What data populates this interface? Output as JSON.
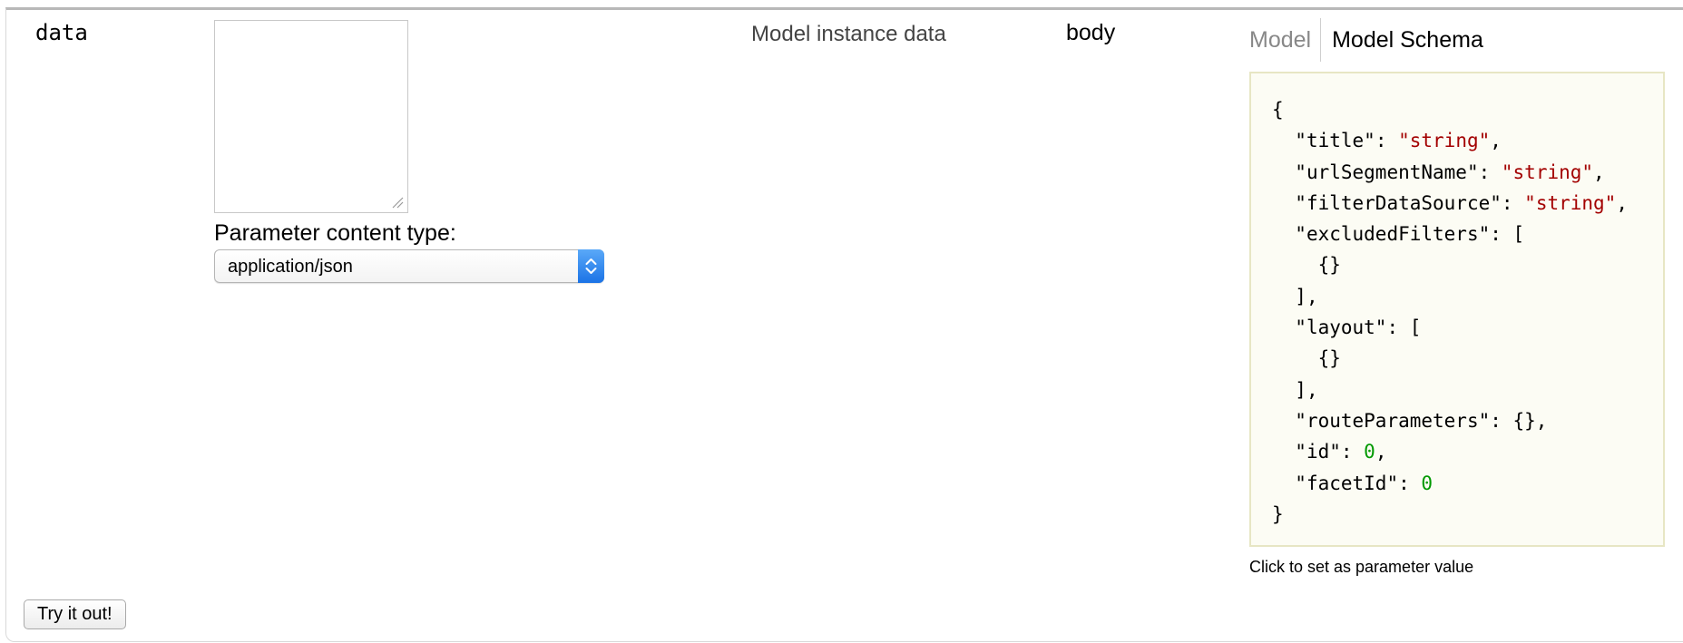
{
  "parameter": {
    "name": "data",
    "value": "",
    "description": "Model instance data",
    "param_type": "body"
  },
  "content_type": {
    "label": "Parameter content type:",
    "selected": "application/json"
  },
  "schema_tabs": {
    "model_label": "Model",
    "schema_label": "Model Schema",
    "active": "Model Schema"
  },
  "schema": {
    "lines": [
      {
        "indent": 0,
        "key": "",
        "punct_before": "{",
        "value": "",
        "value_kind": "",
        "punct_after": ""
      },
      {
        "indent": 1,
        "key": "\"title\"",
        "punct_before": ": ",
        "value": "\"string\"",
        "value_kind": "str",
        "punct_after": ","
      },
      {
        "indent": 1,
        "key": "\"urlSegmentName\"",
        "punct_before": ": ",
        "value": "\"string\"",
        "value_kind": "str",
        "punct_after": ","
      },
      {
        "indent": 1,
        "key": "\"filterDataSource\"",
        "punct_before": ": ",
        "value": "\"string\"",
        "value_kind": "str",
        "punct_after": ","
      },
      {
        "indent": 1,
        "key": "\"excludedFilters\"",
        "punct_before": ": [",
        "value": "",
        "value_kind": "",
        "punct_after": ""
      },
      {
        "indent": 2,
        "key": "",
        "punct_before": "{}",
        "value": "",
        "value_kind": "",
        "punct_after": ""
      },
      {
        "indent": 1,
        "key": "",
        "punct_before": "],",
        "value": "",
        "value_kind": "",
        "punct_after": ""
      },
      {
        "indent": 1,
        "key": "\"layout\"",
        "punct_before": ": [",
        "value": "",
        "value_kind": "",
        "punct_after": ""
      },
      {
        "indent": 2,
        "key": "",
        "punct_before": "{}",
        "value": "",
        "value_kind": "",
        "punct_after": ""
      },
      {
        "indent": 1,
        "key": "",
        "punct_before": "],",
        "value": "",
        "value_kind": "",
        "punct_after": ""
      },
      {
        "indent": 1,
        "key": "\"routeParameters\"",
        "punct_before": ": {},",
        "value": "",
        "value_kind": "",
        "punct_after": ""
      },
      {
        "indent": 1,
        "key": "\"id\"",
        "punct_before": ": ",
        "value": "0",
        "value_kind": "num",
        "punct_after": ","
      },
      {
        "indent": 1,
        "key": "\"facetId\"",
        "punct_before": ": ",
        "value": "0",
        "value_kind": "num",
        "punct_after": ""
      },
      {
        "indent": 0,
        "key": "",
        "punct_before": "}",
        "value": "",
        "value_kind": "",
        "punct_after": ""
      }
    ],
    "hint": "Click to set as parameter value"
  },
  "actions": {
    "try_label": "Try it out!"
  },
  "colors": {
    "string_value": "#a30000",
    "number_value": "#009900",
    "schema_border": "#e7e6c4",
    "select_accent": "#1b73e6"
  }
}
